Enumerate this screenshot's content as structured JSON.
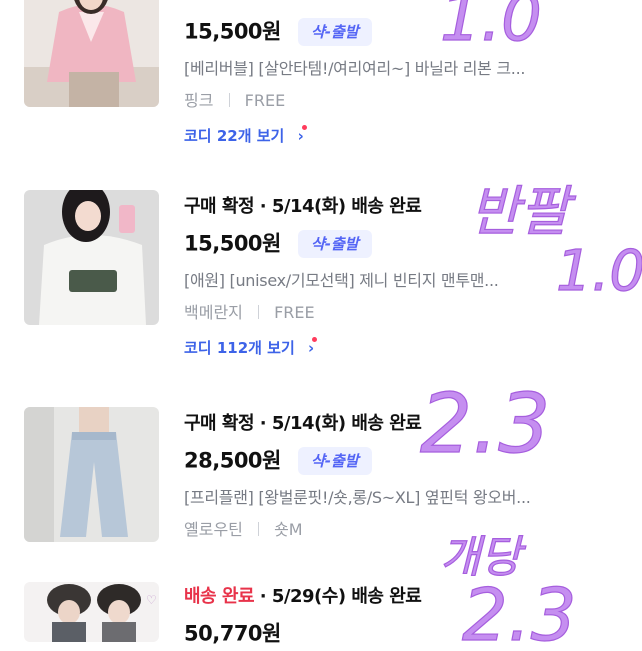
{
  "orders": [
    {
      "status": "",
      "status_suffix": "",
      "price": "15,500원",
      "badge": "샥-출발",
      "name": "[베리버블] [살안타템!/여리여리~] 바닐라 리본 크...",
      "option_color": "핑크",
      "option_size": "FREE",
      "codi_label": "코디 22개 보기",
      "thumb_desc": "pink-cardigan-photo"
    },
    {
      "status": "구매 확정",
      "status_suffix": " · 5/14(화) 배송 완료",
      "price": "15,500원",
      "badge": "샥-출발",
      "name": "[애원] [unisex/기모선택] 제니 빈티지 맨투맨...",
      "option_color": "백메란지",
      "option_size": "FREE",
      "codi_label": "코디 112개 보기",
      "thumb_desc": "white-sweatshirt-photo"
    },
    {
      "status": "구매 확정",
      "status_suffix": " · 5/14(화) 배송 완료",
      "price": "28,500원",
      "badge": "샥-출발",
      "name": "[프리플랜] [왕벌룬핏!/숏,롱/S~XL] 옆핀턱 왕오버...",
      "option_color": "옐로우틴",
      "option_size": "숏M",
      "codi_label": "",
      "thumb_desc": "wide-jeans-photo"
    },
    {
      "status": "배송 완료",
      "status_suffix": " · 5/29(수) 배송 완료",
      "price": "50,770원",
      "badge": "",
      "name": "",
      "option_color": "",
      "option_size": "",
      "codi_label": "",
      "thumb_desc": "two-people-photo"
    }
  ],
  "handwriting": {
    "note1": "1.0",
    "note2_word": "반팔",
    "note2_value": "1.0",
    "note3": "2.3",
    "note4_word": "개당",
    "note4_value": "2.3"
  },
  "colors": {
    "badge_text": "#5465f5",
    "badge_bg": "#eef1ff",
    "link_blue": "#3d63e8",
    "status_red": "#e8334a",
    "handwriting_purple": "#b572e6"
  }
}
